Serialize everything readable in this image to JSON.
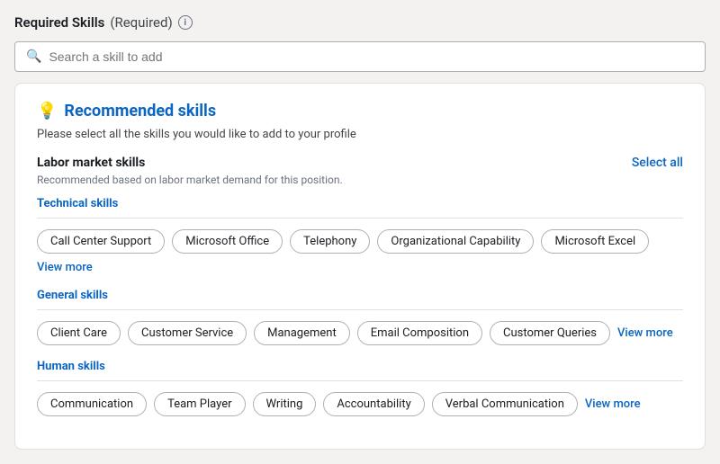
{
  "header": {
    "title": "Required Skills",
    "required_label": "(Required)",
    "info_icon_label": "i"
  },
  "search": {
    "placeholder": "Search a skill to add"
  },
  "card": {
    "recommended_title": "Recommended skills",
    "description": "Please select all the skills you would like to add to your profile",
    "labor_market_section": {
      "label": "Labor market skills",
      "select_all": "Select all",
      "sub_label": "Recommended based on labor market demand for this position."
    },
    "technical_skills": {
      "label": "Technical skills",
      "skills": [
        "Call Center Support",
        "Microsoft Office",
        "Telephony",
        "Organizational Capability",
        "Microsoft Excel"
      ],
      "view_more": "View more"
    },
    "general_skills": {
      "label": "General skills",
      "skills": [
        "Client Care",
        "Customer Service",
        "Management",
        "Email Composition",
        "Customer Queries"
      ],
      "view_more": "View more"
    },
    "human_skills": {
      "label": "Human skills",
      "skills": [
        "Communication",
        "Team Player",
        "Writing",
        "Accountability",
        "Verbal Communication"
      ],
      "view_more": "View more"
    }
  },
  "colors": {
    "accent": "#0a66c2"
  }
}
